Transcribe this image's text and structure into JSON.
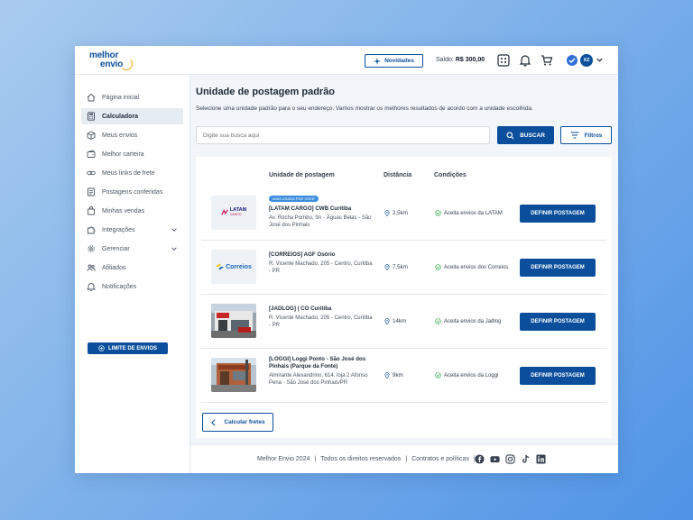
{
  "header": {
    "logo_line1": "melhor",
    "logo_line2": "envio",
    "news_label": "Novidades",
    "balance_label": "Saldo:",
    "balance_value": "R$ 300,00",
    "avatar_initials": "XZ"
  },
  "sidebar": {
    "items": [
      {
        "label": "Página inicial",
        "icon": "home-icon"
      },
      {
        "label": "Calculadora",
        "icon": "calculator-icon"
      },
      {
        "label": "Meus envios",
        "icon": "box-icon"
      },
      {
        "label": "Melhor carteira",
        "icon": "wallet-icon"
      },
      {
        "label": "Meus links de frete",
        "icon": "link-icon"
      },
      {
        "label": "Postagens conferidas",
        "icon": "checklist-icon"
      },
      {
        "label": "Minhas vendas",
        "icon": "bag-icon"
      },
      {
        "label": "Integrações",
        "icon": "puzzle-icon"
      },
      {
        "label": "Gerenciar",
        "icon": "gear-icon"
      },
      {
        "label": "Afiliados",
        "icon": "users-icon"
      },
      {
        "label": "Notificações",
        "icon": "bell-icon"
      }
    ],
    "limit_button": "LIMITE DE ENVIOS"
  },
  "main": {
    "title": "Unidade de postagem padrão",
    "subtitle": "Selecione uma unidade padrão para o seu endereço. Vamos mostrar os melhores resultados de acordo com a unidade escolhida.",
    "search_placeholder": "Digite sua busca aqui",
    "search_button": "BUSCAR",
    "filter_button": "Filtros",
    "columns": [
      "Unidade de postagem",
      "Distância",
      "Condições"
    ],
    "rows": [
      {
        "badge": "MAIS USADA POR VOCÊ",
        "name": "[LATAM CARGO] CWB Curitiba",
        "address": "Av. Rocha Pombo, Sn - Águas Belas - São José dos Pinhais",
        "distance": "2,5km",
        "condition": "Aceita envios da LATAM",
        "action": "DEFINIR POSTAGEM",
        "logo_text": "LATAM",
        "logo_sub": "CARGO"
      },
      {
        "badge": "",
        "name": "[CORREIOS] AGF Osório",
        "address": "R. Vicente Machado, 205 - Centro, Curitiba - PR",
        "distance": "7,5km",
        "condition": "Aceita envios dos Correios",
        "action": "DEFINIR POSTAGEM",
        "logo_text": "Correios"
      },
      {
        "badge": "",
        "name": "[JADLOG] | CO Curitiba",
        "address": "R. Vicente Machado, 205 - Centro, Curitiba - PR",
        "distance": "14km",
        "condition": "Aceita envios da Jadlog",
        "action": "DEFINIR POSTAGEM"
      },
      {
        "badge": "",
        "name": "[LOGGI] Loggi Ponto - São José dos Pinhais (Parque da Fonte)",
        "address": "Almirante Alexandrino, 614, loja 2 Afonso Pena - São José dos Pinhais/PR",
        "distance": "9km",
        "condition": "Aceita envios da Loggi",
        "action": "DEFINIR POSTAGEM"
      }
    ],
    "back_button": "Calcular fretes"
  },
  "footer": {
    "copyright": "Melhor Envio 2024",
    "rights": "Todos os direitos reservados",
    "policies": "Contratos e políticas",
    "sep": "|"
  },
  "colors": {
    "primary": "#0b4f9c",
    "accent": "#f2a516",
    "badge": "#3f8fe0",
    "success": "#2aa84a"
  }
}
